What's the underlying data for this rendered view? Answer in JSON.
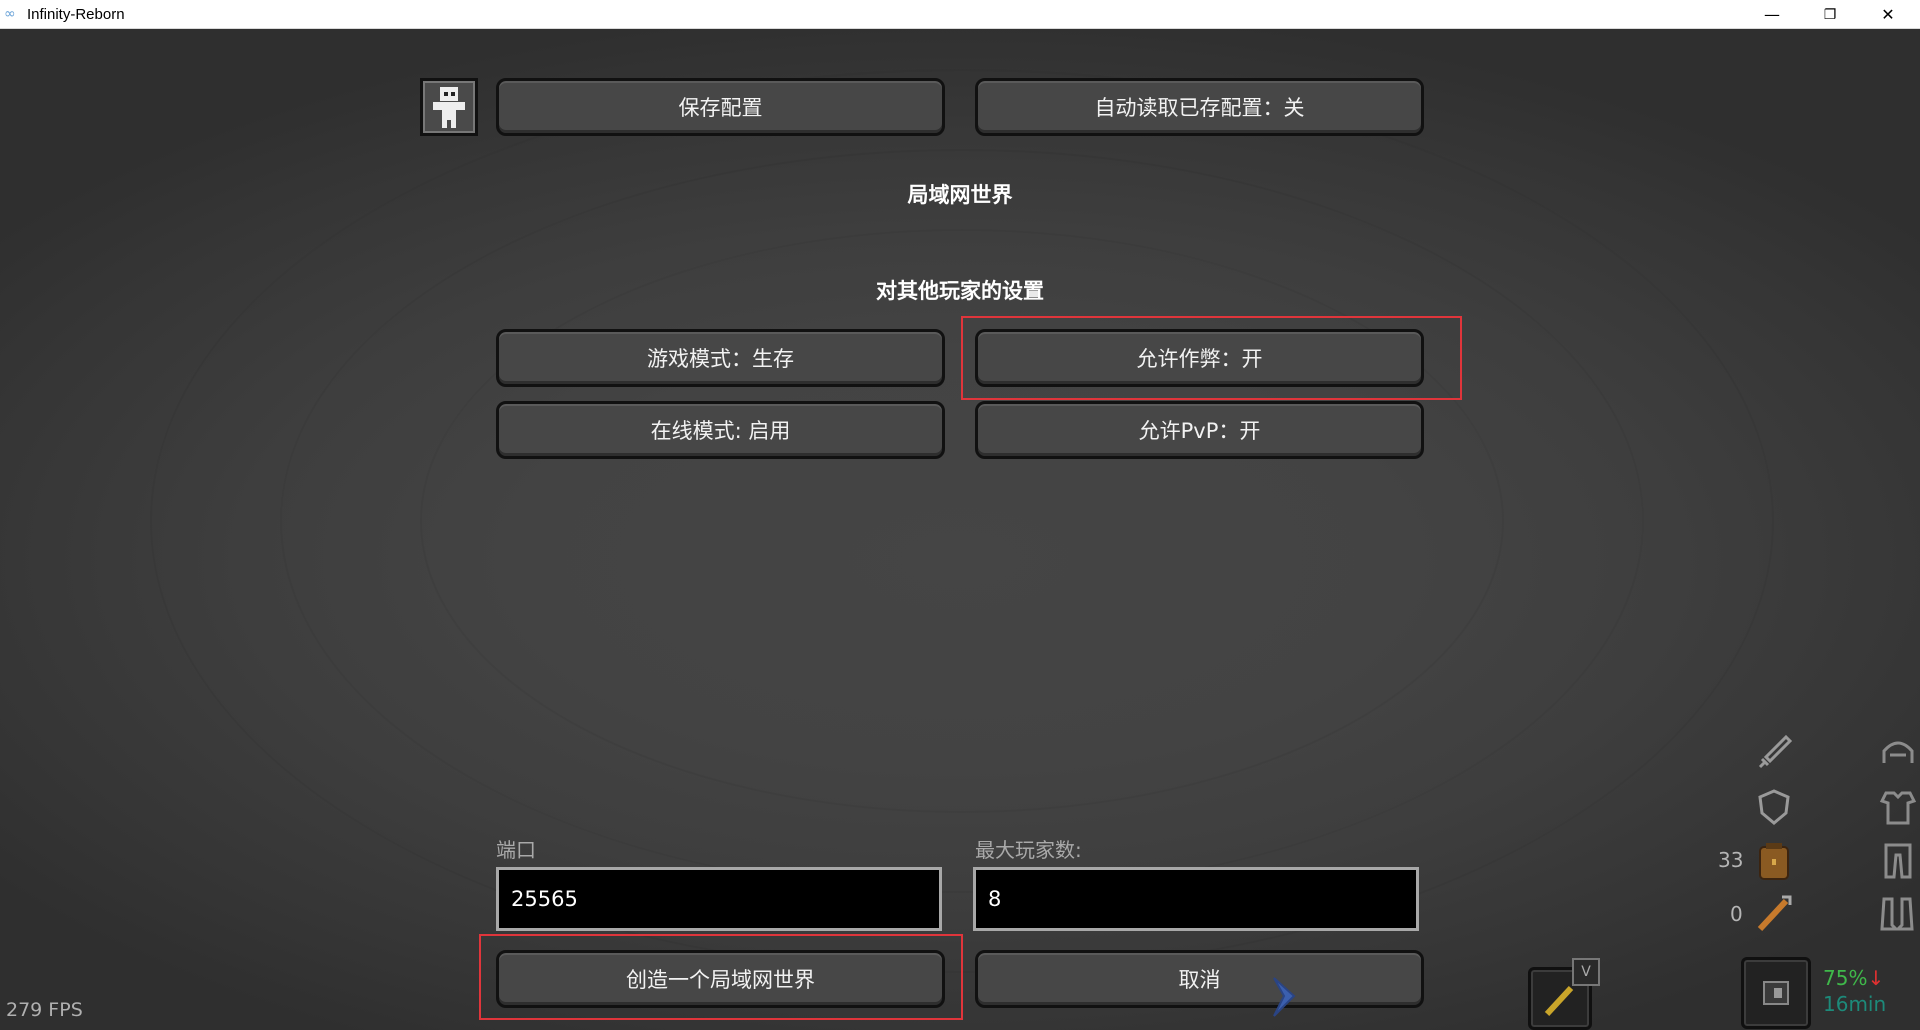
{
  "window": {
    "title": "Infinity-Reborn",
    "minimize_icon": "—",
    "restore_icon": "❐",
    "close_icon": "✕"
  },
  "top": {
    "save_config": "保存配置",
    "auto_load_config": "自动读取已存配置：关"
  },
  "lan_title": "局域网世界",
  "other_players_title": "对其他玩家的设置",
  "options": {
    "game_mode": "游戏模式：生存",
    "allow_cheats": "允许作弊：开",
    "online_mode": "在线模式: 启用",
    "allow_pvp": "允许PvP：开"
  },
  "port": {
    "label": "端口",
    "value": "25565"
  },
  "max_players": {
    "label": "最大玩家数:",
    "value": "8"
  },
  "create_lan": "创造一个局域网世界",
  "cancel": "取消",
  "fps": "279 FPS",
  "hud": {
    "backpack_count": "33",
    "arrow_count": "0",
    "hotkey": "V",
    "percent": "75%",
    "trend": "↓",
    "time": "16min"
  },
  "icons": {
    "skin": "skin-customize-icon",
    "sword": "sword-icon",
    "shield": "shield-icon",
    "backpack": "backpack-icon",
    "arrow": "arrow-icon",
    "helmet": "helmet-icon",
    "chestplate": "chestplate-icon",
    "leggings": "leggings-icon",
    "boots": "boots-icon"
  },
  "colors": {
    "highlight": "#e0353b",
    "percent": "#3fb84a",
    "time": "#1d8a7a"
  }
}
